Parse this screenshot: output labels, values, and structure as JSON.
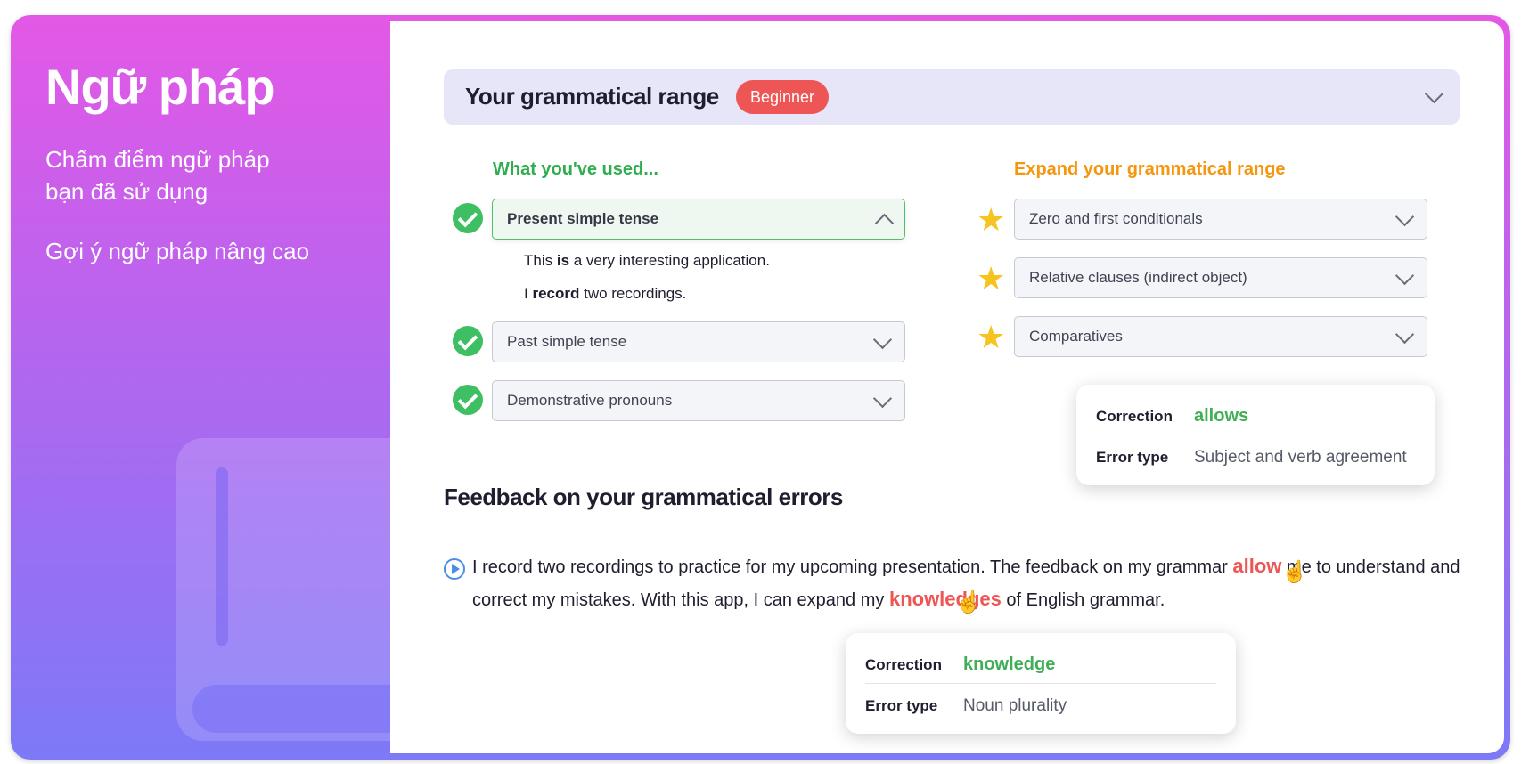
{
  "hero": {
    "title": "Ngữ pháp",
    "subtitle": "Chấm điểm ngữ pháp bạn đã sử dụng",
    "subtitle2": "Gợi ý ngữ pháp nâng cao"
  },
  "range": {
    "title": "Your grammatical range",
    "level_badge": "Beginner"
  },
  "used": {
    "heading": "What you've used...",
    "items": [
      {
        "label": "Present simple tense",
        "expanded": true
      },
      {
        "label": "Past simple tense",
        "expanded": false
      },
      {
        "label": "Demonstrative pronouns",
        "expanded": false
      }
    ],
    "examples": [
      {
        "pre": "This ",
        "bold": "is",
        "post": " a very interesting application."
      },
      {
        "pre": "I ",
        "bold": "record",
        "post": " two recordings."
      }
    ]
  },
  "expand": {
    "heading": "Expand your grammatical range",
    "items": [
      {
        "label": "Zero and first conditionals"
      },
      {
        "label": "Relative clauses (indirect object)"
      },
      {
        "label": "Comparatives"
      }
    ]
  },
  "feedback": {
    "title": "Feedback on your grammatical errors",
    "text_1": "I record two recordings to practice for my upcoming presentation. The feedback on my grammar ",
    "error_1": "allow",
    "text_2": " me to understand and correct my mistakes. With this app, I can expand my ",
    "error_2": "knowledges",
    "text_3": " of English grammar."
  },
  "popups": [
    {
      "correction_label": "Correction",
      "correction": "allows",
      "type_label": "Error type",
      "type": "Subject and verb agreement"
    },
    {
      "correction_label": "Correction",
      "correction": "knowledge",
      "type_label": "Error type",
      "type": "Noun plurality"
    }
  ],
  "colors": {
    "gradient_top": "#e458e6",
    "gradient_bottom": "#7d79f7",
    "used_heading": "#2fae4f",
    "expand_heading": "#f5960f",
    "error": "#ee5555",
    "correction": "#3fae57",
    "badge": "#ee5555"
  },
  "icons": {
    "check": "check-circle-icon",
    "star": "star-icon",
    "play": "play-circle-icon",
    "cursor": "hand-pointer-icon",
    "chevron": "chevron-down-icon"
  }
}
